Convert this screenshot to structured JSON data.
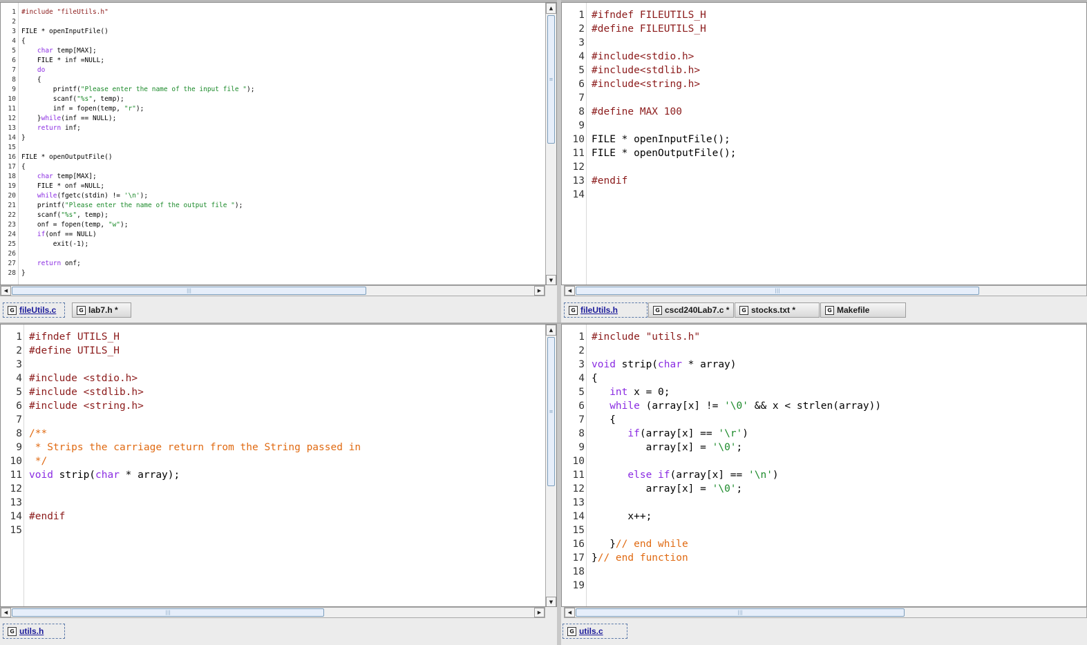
{
  "panes": [
    {
      "id": "top-left",
      "file": "fileUtils.c",
      "lines": [
        {
          "n": "1",
          "t": [
            [
              "pre",
              "#include \"fileUtils.h\""
            ]
          ]
        },
        {
          "n": "2",
          "t": []
        },
        {
          "n": "3",
          "t": [
            [
              "id",
              "FILE * openInputFile()"
            ]
          ]
        },
        {
          "n": "4",
          "t": [
            [
              "id",
              "{"
            ]
          ]
        },
        {
          "n": "5",
          "t": [
            [
              "id",
              "    "
            ],
            [
              "kw",
              "char"
            ],
            [
              "id",
              " temp[MAX];"
            ]
          ]
        },
        {
          "n": "6",
          "t": [
            [
              "id",
              "    FILE * inf =NULL;"
            ]
          ]
        },
        {
          "n": "7",
          "t": [
            [
              "id",
              "    "
            ],
            [
              "kw",
              "do"
            ]
          ]
        },
        {
          "n": "8",
          "t": [
            [
              "id",
              "    {"
            ]
          ]
        },
        {
          "n": "9",
          "t": [
            [
              "id",
              "        printf("
            ],
            [
              "str",
              "\"Please enter the name of the input file \""
            ],
            [
              "id",
              ");"
            ]
          ]
        },
        {
          "n": "10",
          "t": [
            [
              "id",
              "        scanf("
            ],
            [
              "str",
              "\"%s\""
            ],
            [
              "id",
              ", temp);"
            ]
          ]
        },
        {
          "n": "11",
          "t": [
            [
              "id",
              "        inf = fopen(temp, "
            ],
            [
              "str",
              "\"r\""
            ],
            [
              "id",
              ");"
            ]
          ]
        },
        {
          "n": "12",
          "t": [
            [
              "id",
              "    }"
            ],
            [
              "kw",
              "while"
            ],
            [
              "id",
              "(inf == NULL);"
            ]
          ]
        },
        {
          "n": "13",
          "t": [
            [
              "id",
              "    "
            ],
            [
              "kw",
              "return"
            ],
            [
              "id",
              " inf;"
            ]
          ]
        },
        {
          "n": "14",
          "t": [
            [
              "id",
              "}"
            ]
          ]
        },
        {
          "n": "15",
          "t": []
        },
        {
          "n": "16",
          "t": [
            [
              "id",
              "FILE * openOutputFile()"
            ]
          ]
        },
        {
          "n": "17",
          "t": [
            [
              "id",
              "{"
            ]
          ]
        },
        {
          "n": "18",
          "t": [
            [
              "id",
              "    "
            ],
            [
              "kw",
              "char"
            ],
            [
              "id",
              " temp[MAX];"
            ]
          ]
        },
        {
          "n": "19",
          "t": [
            [
              "id",
              "    FILE * onf =NULL;"
            ]
          ]
        },
        {
          "n": "20",
          "t": [
            [
              "id",
              "    "
            ],
            [
              "kw",
              "while"
            ],
            [
              "id",
              "(fgetc(stdin) != "
            ],
            [
              "str",
              "'\\n'"
            ],
            [
              "id",
              ");"
            ]
          ]
        },
        {
          "n": "21",
          "t": [
            [
              "id",
              "    printf("
            ],
            [
              "str",
              "\"Please enter the name of the output file \""
            ],
            [
              "id",
              ");"
            ]
          ]
        },
        {
          "n": "22",
          "t": [
            [
              "id",
              "    scanf("
            ],
            [
              "str",
              "\"%s\""
            ],
            [
              "id",
              ", temp);"
            ]
          ]
        },
        {
          "n": "23",
          "t": [
            [
              "id",
              "    onf = fopen(temp, "
            ],
            [
              "str",
              "\"w\""
            ],
            [
              "id",
              ");"
            ]
          ]
        },
        {
          "n": "24",
          "t": [
            [
              "id",
              "    "
            ],
            [
              "kw",
              "if"
            ],
            [
              "id",
              "(onf == NULL)"
            ]
          ]
        },
        {
          "n": "25",
          "t": [
            [
              "id",
              "        exit(-1);"
            ]
          ]
        },
        {
          "n": "26",
          "t": []
        },
        {
          "n": "27",
          "t": [
            [
              "id",
              "    "
            ],
            [
              "kw",
              "return"
            ],
            [
              "id",
              " onf;"
            ]
          ]
        },
        {
          "n": "28",
          "t": [
            [
              "id",
              "}"
            ]
          ]
        }
      ],
      "tabs": [
        {
          "label": "fileUtils.c",
          "active": true
        },
        {
          "label": "lab7.h *",
          "active": false
        }
      ]
    },
    {
      "id": "top-right",
      "file": "fileUtils.h",
      "lines": [
        {
          "n": "1",
          "t": [
            [
              "pre",
              "#ifndef FILEUTILS_H"
            ]
          ]
        },
        {
          "n": "2",
          "t": [
            [
              "pre",
              "#define FILEUTILS_H"
            ]
          ]
        },
        {
          "n": "3",
          "t": []
        },
        {
          "n": "4",
          "t": [
            [
              "pre",
              "#include<stdio.h>"
            ]
          ]
        },
        {
          "n": "5",
          "t": [
            [
              "pre",
              "#include<stdlib.h>"
            ]
          ]
        },
        {
          "n": "6",
          "t": [
            [
              "pre",
              "#include<string.h>"
            ]
          ]
        },
        {
          "n": "7",
          "t": []
        },
        {
          "n": "8",
          "t": [
            [
              "pre",
              "#define MAX 100"
            ]
          ]
        },
        {
          "n": "9",
          "t": []
        },
        {
          "n": "10",
          "t": [
            [
              "id",
              "FILE * openInputFile();"
            ]
          ]
        },
        {
          "n": "11",
          "t": [
            [
              "id",
              "FILE * openOutputFile();"
            ]
          ]
        },
        {
          "n": "12",
          "t": []
        },
        {
          "n": "13",
          "t": [
            [
              "pre",
              "#endif"
            ]
          ]
        },
        {
          "n": "14",
          "t": []
        }
      ],
      "tabs": [
        {
          "label": "fileUtils.h",
          "active": true
        },
        {
          "label": "cscd240Lab7.c *",
          "active": false
        },
        {
          "label": "stocks.txt *",
          "active": false
        },
        {
          "label": "Makefile",
          "active": false
        }
      ]
    },
    {
      "id": "bottom-left",
      "file": "utils.h",
      "lines": [
        {
          "n": "1",
          "t": [
            [
              "pre",
              "#ifndef UTILS_H"
            ]
          ]
        },
        {
          "n": "2",
          "t": [
            [
              "pre",
              "#define UTILS_H"
            ]
          ]
        },
        {
          "n": "3",
          "t": []
        },
        {
          "n": "4",
          "t": [
            [
              "pre",
              "#include <stdio.h>"
            ]
          ]
        },
        {
          "n": "5",
          "t": [
            [
              "pre",
              "#include <stdlib.h>"
            ]
          ]
        },
        {
          "n": "6",
          "t": [
            [
              "pre",
              "#include <string.h>"
            ]
          ]
        },
        {
          "n": "7",
          "t": []
        },
        {
          "n": "8",
          "t": [
            [
              "cmt",
              "/**"
            ]
          ]
        },
        {
          "n": "9",
          "t": [
            [
              "cmt",
              " * Strips the carriage return from the String passed in"
            ]
          ]
        },
        {
          "n": "10",
          "t": [
            [
              "cmt",
              " */"
            ]
          ]
        },
        {
          "n": "11",
          "t": [
            [
              "kw",
              "void"
            ],
            [
              "id",
              " strip("
            ],
            [
              "kw",
              "char"
            ],
            [
              "id",
              " * array);"
            ]
          ]
        },
        {
          "n": "12",
          "t": []
        },
        {
          "n": "13",
          "t": []
        },
        {
          "n": "14",
          "t": [
            [
              "pre",
              "#endif"
            ]
          ]
        },
        {
          "n": "15",
          "t": []
        }
      ],
      "tabs": [
        {
          "label": "utils.h",
          "active": true
        }
      ]
    },
    {
      "id": "bottom-right",
      "file": "utils.c",
      "lines": [
        {
          "n": "1",
          "t": [
            [
              "pre",
              "#include \"utils.h\""
            ]
          ]
        },
        {
          "n": "2",
          "t": []
        },
        {
          "n": "3",
          "t": [
            [
              "kw",
              "void"
            ],
            [
              "id",
              " strip("
            ],
            [
              "kw",
              "char"
            ],
            [
              "id",
              " * array)"
            ]
          ]
        },
        {
          "n": "4",
          "t": [
            [
              "id",
              "{"
            ]
          ]
        },
        {
          "n": "5",
          "t": [
            [
              "id",
              "   "
            ],
            [
              "kw",
              "int"
            ],
            [
              "id",
              " x = 0;"
            ]
          ]
        },
        {
          "n": "6",
          "t": [
            [
              "id",
              "   "
            ],
            [
              "kw",
              "while"
            ],
            [
              "id",
              " (array[x] != "
            ],
            [
              "str",
              "'\\0'"
            ],
            [
              "id",
              " && x < strlen(array))"
            ]
          ]
        },
        {
          "n": "7",
          "t": [
            [
              "id",
              "   {"
            ]
          ]
        },
        {
          "n": "8",
          "t": [
            [
              "id",
              "      "
            ],
            [
              "kw",
              "if"
            ],
            [
              "id",
              "(array[x] == "
            ],
            [
              "str",
              "'\\r'"
            ],
            [
              "id",
              ")"
            ]
          ]
        },
        {
          "n": "9",
          "t": [
            [
              "id",
              "         array[x] = "
            ],
            [
              "str",
              "'\\0'"
            ],
            [
              "id",
              ";"
            ]
          ]
        },
        {
          "n": "10",
          "t": []
        },
        {
          "n": "11",
          "t": [
            [
              "id",
              "      "
            ],
            [
              "kw",
              "else if"
            ],
            [
              "id",
              "(array[x] == "
            ],
            [
              "str",
              "'\\n'"
            ],
            [
              "id",
              ")"
            ]
          ]
        },
        {
          "n": "12",
          "t": [
            [
              "id",
              "         array[x] = "
            ],
            [
              "str",
              "'\\0'"
            ],
            [
              "id",
              ";"
            ]
          ]
        },
        {
          "n": "13",
          "t": []
        },
        {
          "n": "14",
          "t": [
            [
              "id",
              "      x++;"
            ]
          ]
        },
        {
          "n": "15",
          "t": []
        },
        {
          "n": "16",
          "t": [
            [
              "id",
              "   }"
            ],
            [
              "cmt",
              "// end while"
            ]
          ]
        },
        {
          "n": "17",
          "t": [
            [
              "id",
              "}"
            ],
            [
              "cmt",
              "// end function"
            ]
          ]
        },
        {
          "n": "18",
          "t": []
        },
        {
          "n": "19",
          "t": []
        }
      ],
      "tabs": [
        {
          "label": "utils.c",
          "active": true
        }
      ]
    }
  ],
  "icons": {
    "file_tab_icon": "java-file-icon",
    "scroll_up": "arrow-up-icon",
    "scroll_down": "arrow-down-icon",
    "scroll_left": "arrow-left-icon",
    "scroll_right": "arrow-right-icon"
  },
  "colors": {
    "keyword": "#8a2be2",
    "preprocessor": "#8b1a1a",
    "string": "#1b8a2a",
    "comment": "#e06a12"
  }
}
